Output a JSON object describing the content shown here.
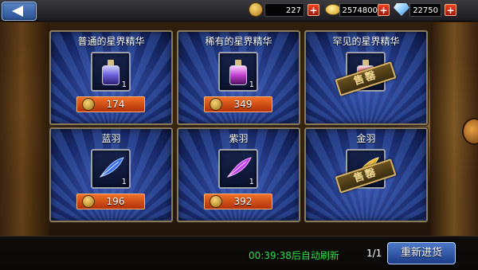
{
  "currencies": [
    {
      "name": "medal-icon",
      "value": "227"
    },
    {
      "name": "gold-coin-icon",
      "value": "2574800"
    },
    {
      "name": "diamond-icon",
      "value": "22750"
    }
  ],
  "plus_symbol": "+",
  "shop_items": [
    {
      "title": "普通的星界精华",
      "icon": "blue-essence-bottle-icon",
      "quantity": "1",
      "price": "174",
      "sold_out": false,
      "color": "#6a5cd8"
    },
    {
      "title": "稀有的星界精华",
      "icon": "purple-essence-bottle-icon",
      "quantity": "1",
      "price": "349",
      "sold_out": false,
      "color": "#c040d0"
    },
    {
      "title": "罕见的星界精华",
      "icon": "red-essence-bottle-icon",
      "quantity": "",
      "price": "",
      "sold_out": true,
      "sold_label": "售罄",
      "color": "#4060d0"
    },
    {
      "title": "蓝羽",
      "icon": "blue-feather-icon",
      "quantity": "1",
      "price": "196",
      "sold_out": false,
      "color": "#3a6ef0"
    },
    {
      "title": "紫羽",
      "icon": "purple-feather-icon",
      "quantity": "1",
      "price": "392",
      "sold_out": false,
      "color": "#c040f0"
    },
    {
      "title": "金羽",
      "icon": "gold-feather-icon",
      "quantity": "",
      "price": "",
      "sold_out": true,
      "sold_label": "售罄",
      "color": "#f0b020"
    }
  ],
  "footer": {
    "refresh_timer": "00:39:38后自动刷新",
    "page_indicator": "1/1",
    "refresh_button": "重新进货"
  }
}
